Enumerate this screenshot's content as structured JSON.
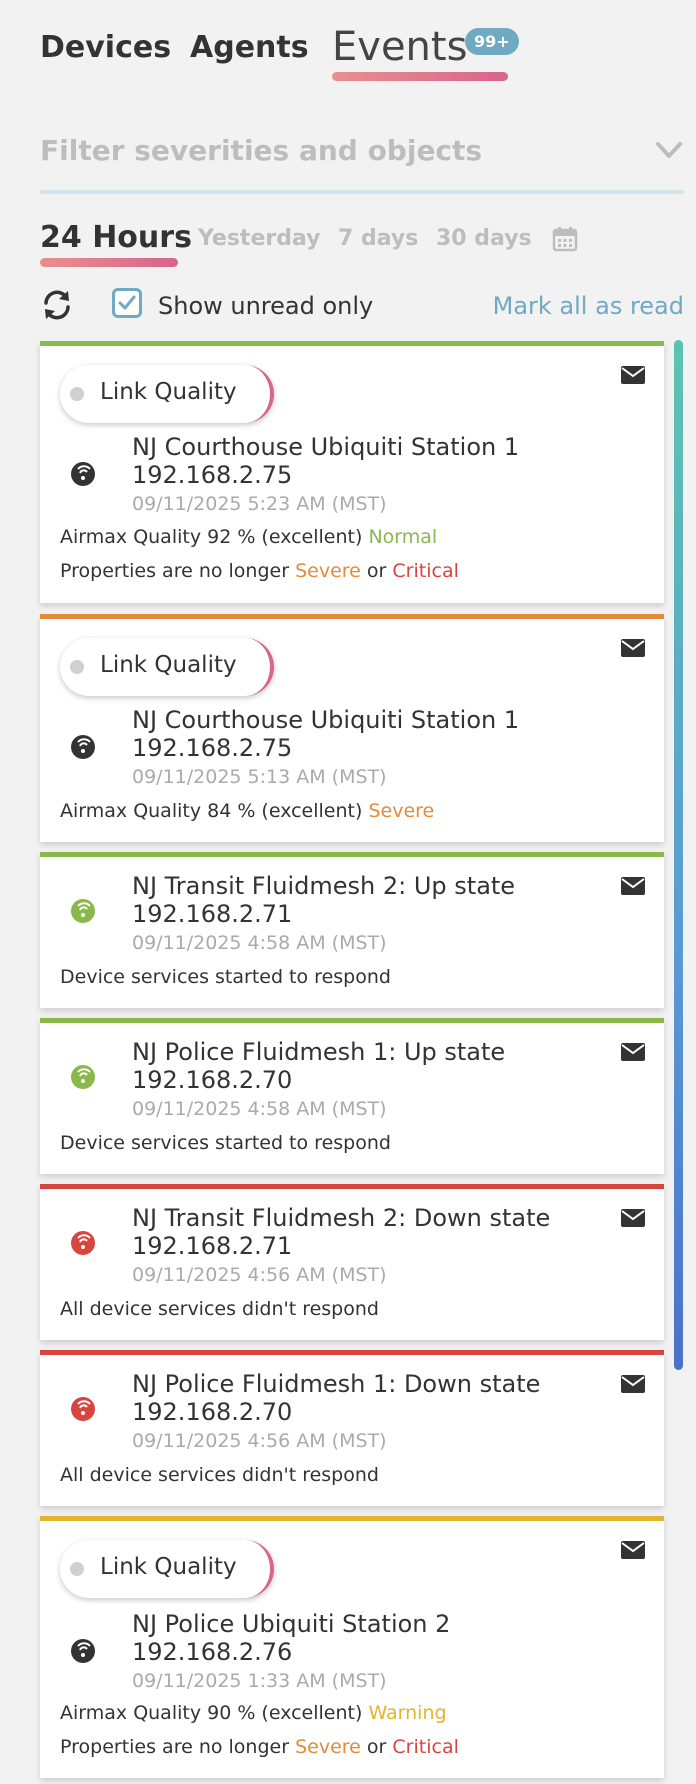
{
  "tabs": {
    "devices": "Devices",
    "agents": "Agents",
    "events": "Events",
    "events_badge": "99+"
  },
  "filter": {
    "placeholder": "Filter severities and objects"
  },
  "range": {
    "active": "24 Hours",
    "yesterday": "Yesterday",
    "days7": "7 days",
    "days30": "30 days"
  },
  "controls": {
    "show_unread_label": "Show unread only",
    "show_unread_checked": true,
    "mark_all_label": "Mark all as read"
  },
  "colors": {
    "normal": "#8ab84a",
    "severe": "#e58a3a",
    "critical": "#d9453e",
    "warning": "#e3b42e",
    "accent": "#6fa9c2"
  },
  "events": [
    {
      "pill": "Link Quality",
      "title": "NJ Courthouse Ubiquiti Station 1",
      "ip": "192.168.2.75",
      "time": "09/11/2025 5:23 AM (MST)",
      "line1": "Airmax Quality 92 % (excellent)",
      "status": "Normal",
      "line2_prefix": "Properties are no longer",
      "line2_severe": "Severe",
      "line2_or": "or",
      "line2_critical": "Critical"
    },
    {
      "pill": "Link Quality",
      "title": "NJ Courthouse Ubiquiti Station 1",
      "ip": "192.168.2.75",
      "time": "09/11/2025 5:13 AM (MST)",
      "line1": "Airmax Quality 84 % (excellent)",
      "status": "Severe"
    },
    {
      "title": "NJ Transit Fluidmesh 2: Up state",
      "ip": "192.168.2.71",
      "time": "09/11/2025 4:58 AM (MST)",
      "line1": "Device services started to respond"
    },
    {
      "title": "NJ Police Fluidmesh 1: Up state",
      "ip": "192.168.2.70",
      "time": "09/11/2025 4:58 AM (MST)",
      "line1": "Device services started to respond"
    },
    {
      "title": "NJ Transit Fluidmesh 2: Down state",
      "ip": "192.168.2.71",
      "time": "09/11/2025 4:56 AM (MST)",
      "line1": "All device services didn't respond"
    },
    {
      "title": "NJ Police Fluidmesh 1: Down state",
      "ip": "192.168.2.70",
      "time": "09/11/2025 4:56 AM (MST)",
      "line1": "All device services didn't respond"
    },
    {
      "pill": "Link Quality",
      "title": "NJ Police Ubiquiti Station 2",
      "ip": "192.168.2.76",
      "time": "09/11/2025 1:33 AM (MST)",
      "line1": "Airmax Quality 90 % (excellent)",
      "status": "Warning",
      "line2_prefix": "Properties are no longer",
      "line2_severe": "Severe",
      "line2_or": "or",
      "line2_critical": "Critical"
    }
  ]
}
